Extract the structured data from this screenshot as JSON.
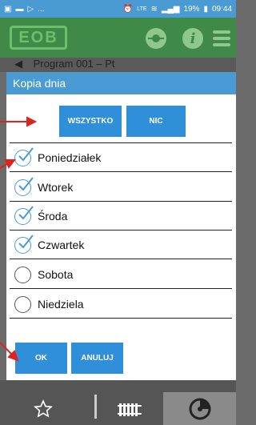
{
  "status_bar": {
    "left_icons": [
      "image-icon",
      "message-icon",
      "play-store-icon"
    ],
    "ellipsis": "...",
    "network": "LTE",
    "battery": "19%",
    "time": "09:44"
  },
  "app_bar": {
    "logo_text": "EOB",
    "info_glyph": "i"
  },
  "sub_header": {
    "title": "Program 001 – Pt"
  },
  "dialog": {
    "title": "Kopia dnia",
    "select_all_label": "WSZYSTKO",
    "select_none_label": "NIC",
    "days": [
      {
        "label": "Poniedziałek",
        "checked": true
      },
      {
        "label": "Wtorek",
        "checked": true
      },
      {
        "label": "Środa",
        "checked": true
      },
      {
        "label": "Czwartek",
        "checked": true
      },
      {
        "label": "Sobota",
        "checked": false
      },
      {
        "label": "Niedziela",
        "checked": false
      }
    ],
    "ok_label": "OK",
    "cancel_label": "ANULUJ"
  },
  "bottom_nav": {
    "items": [
      "star-icon",
      "radiator-icon",
      "dial-icon"
    ],
    "active": "dial-icon"
  },
  "colors": {
    "accent": "#2f8fd8",
    "title_bar": "#4a9ad3",
    "app_bar": "#3f8a49",
    "annotation": "#e0231c"
  }
}
